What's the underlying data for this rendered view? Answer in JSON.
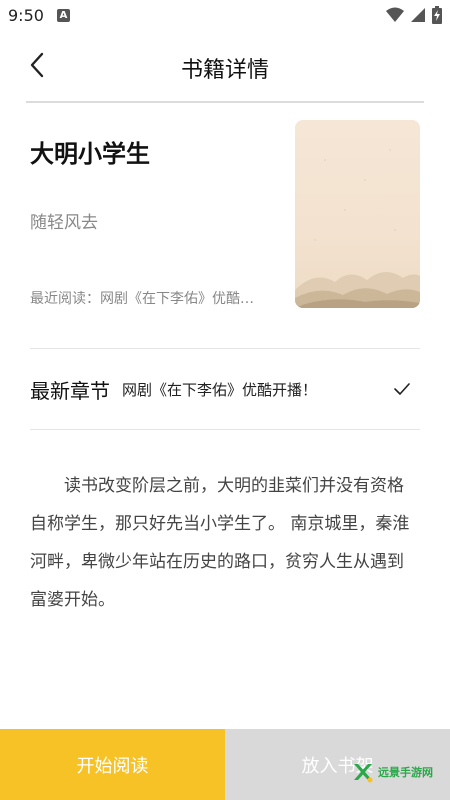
{
  "status_bar": {
    "time": "9:50",
    "notification_icon": "a-icon",
    "icons": [
      "wifi-icon",
      "signal-icon",
      "battery-icon"
    ]
  },
  "header": {
    "title": "书籍详情",
    "back_icon": "back-arrow-icon"
  },
  "book": {
    "title": "大明小学生",
    "author": "随轻风去",
    "recent_read": "最近阅读：网剧《在下李佑》优酷…",
    "cover_icon": "ink-landscape-cover-image"
  },
  "latest": {
    "label": "最新章节",
    "chapter": "网剧《在下李佑》优酷开播！",
    "icon": "check-icon"
  },
  "description": "读书改变阶层之前，大明的韭菜们并没有资格自称学生，那只好先当小学生了。 南京城里，秦淮河畔，卑微少年站在历史的路口，贫穷人生从遇到富婆开始。",
  "bottom": {
    "start_label": "开始阅读",
    "shelf_label": "放入书架"
  },
  "watermark": {
    "text": "远景手游网",
    "icon": "x-logo-icon"
  },
  "colors": {
    "accent": "#f6c226",
    "secondary_button": "#d9d9d9",
    "watermark": "#2aa84a"
  }
}
